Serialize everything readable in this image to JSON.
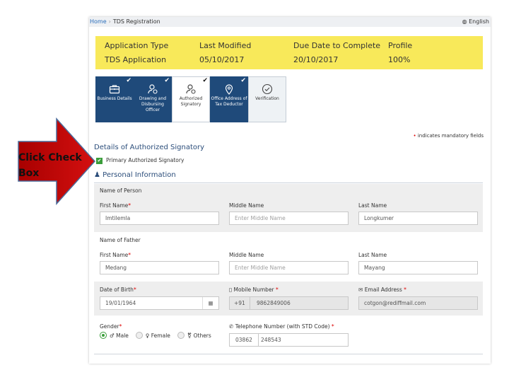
{
  "breadcrumb": {
    "home": "Home",
    "current": "TDS Registration",
    "language": "English"
  },
  "banner": {
    "columns": [
      {
        "label": "Application Type",
        "value": "TDS Application"
      },
      {
        "label": "Last Modified",
        "value": "05/10/2017"
      },
      {
        "label": "Due Date to Complete",
        "value": "20/10/2017"
      },
      {
        "label": "Profile",
        "value": "100%"
      }
    ]
  },
  "steps": [
    {
      "label": "Business Details",
      "icon": "briefcase-icon",
      "state": "done"
    },
    {
      "label": "Drawing and Disbursing Officer",
      "icon": "user-icon",
      "state": "done"
    },
    {
      "label": "Authorized Signatory",
      "icon": "user-icon",
      "state": "current"
    },
    {
      "label": "Office Address of Tax Deductor",
      "icon": "location-pin-icon",
      "state": "done"
    },
    {
      "label": "Verification",
      "icon": "check-circle-icon",
      "state": "pending"
    }
  ],
  "mandatory_note": "indicates mandatory fields",
  "section_title": "Details of Authorized Signatory",
  "primary_checkbox": {
    "label": "Primary Authorized Signatory",
    "checked": true
  },
  "personal_info_title": "Personal Information",
  "name_of_person": {
    "title": "Name of Person",
    "first_label": "First Name",
    "first_value": "Imtilemla",
    "middle_label": "Middle Name",
    "middle_placeholder": "Enter Middle Name",
    "last_label": "Last Name",
    "last_value": "Longkumer"
  },
  "name_of_father": {
    "title": "Name of Father",
    "first_label": "First Name",
    "first_value": "Medang",
    "middle_label": "Middle Name",
    "middle_placeholder": "Enter Middle Name",
    "last_label": "Last Name",
    "last_value": "Mayang"
  },
  "dob": {
    "label": "Date of Birth",
    "value": "19/01/1964"
  },
  "mobile": {
    "label": "Mobile Number",
    "prefix": "+91",
    "value": "9862849006"
  },
  "email": {
    "label": "Email Address",
    "value": "cotgon@rediffmail.com"
  },
  "gender": {
    "label": "Gender",
    "options": [
      "Male",
      "Female",
      "Others"
    ],
    "selected": "Male"
  },
  "telephone": {
    "label": "Telephone Number (with STD Code)",
    "std": "03862",
    "number": "248543"
  },
  "callout": {
    "text": "Click Check Box",
    "color": "#c00000"
  },
  "colors": {
    "banner": "#f8e95a",
    "step_done": "#1f4a7a",
    "link": "#2a6ebb",
    "check_green": "#3a9d3a"
  }
}
